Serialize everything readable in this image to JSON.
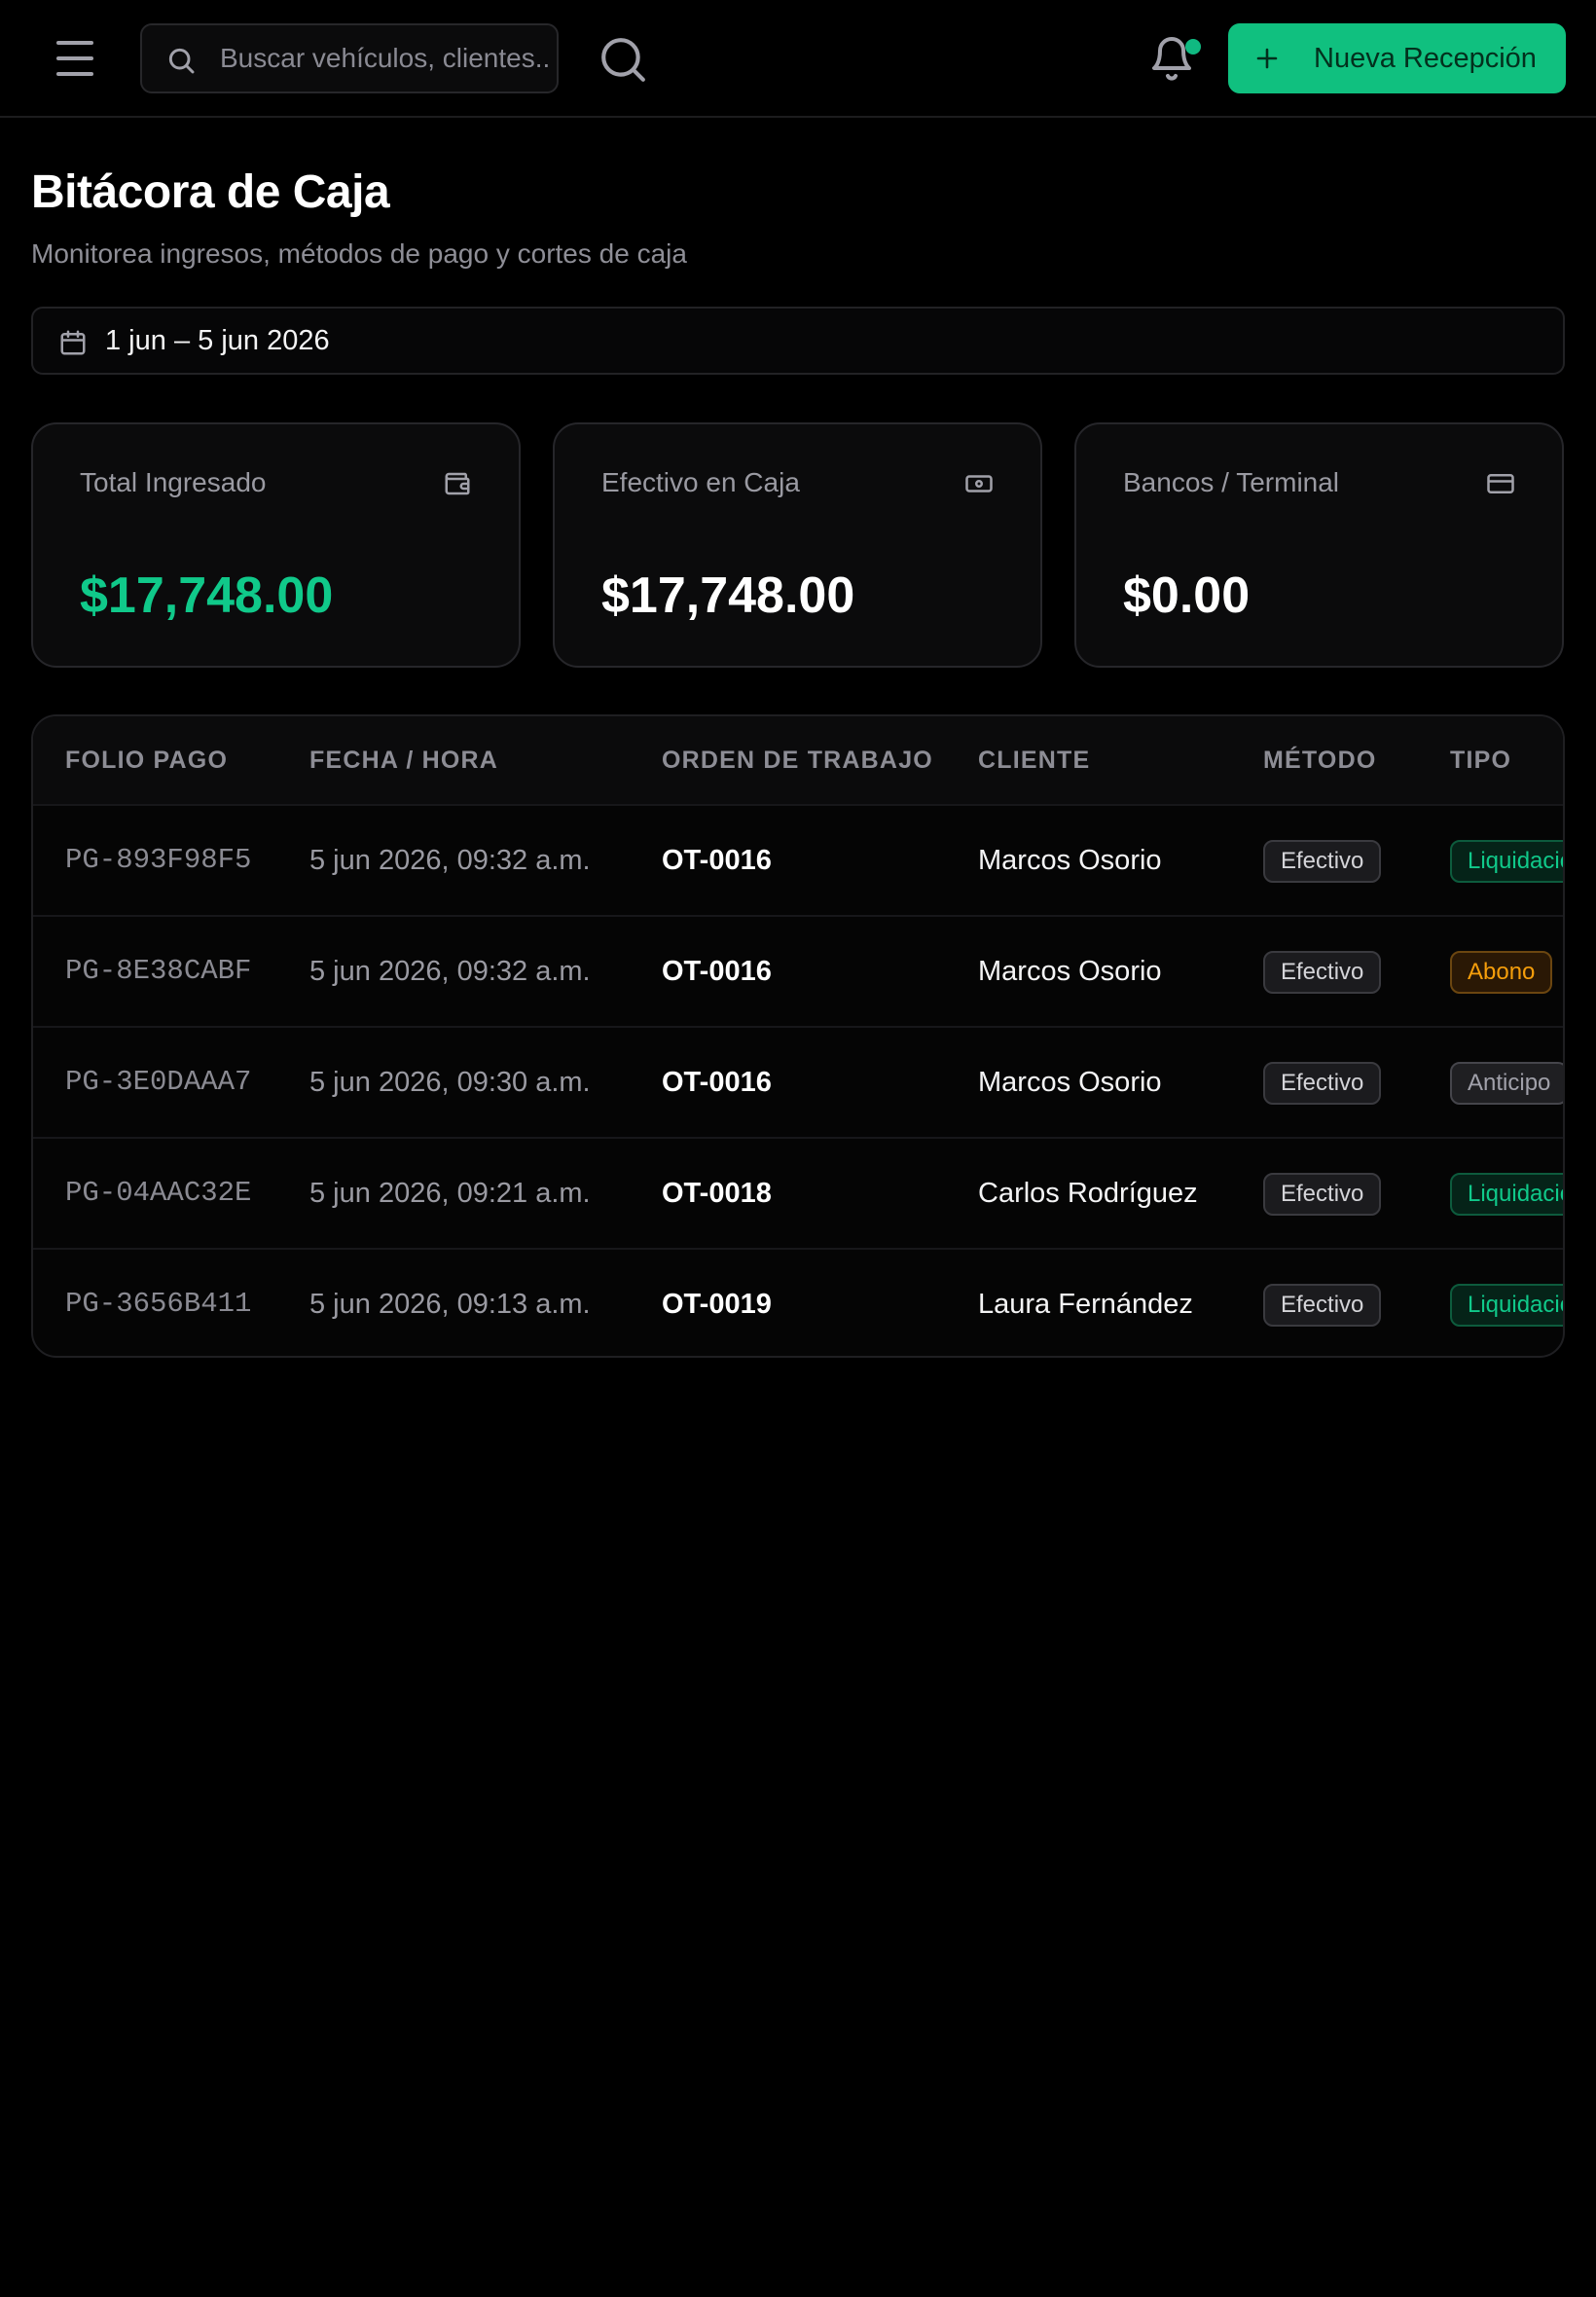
{
  "topbar": {
    "search_placeholder": "Buscar vehículos, clientes...",
    "new_button_label": "Nueva Recepción",
    "accent_color": "#10c07f",
    "notification_dot": true
  },
  "header": {
    "title": "Bitácora de Caja",
    "subtitle": "Monitorea ingresos, métodos de pago y cortes de caja",
    "date_range": "1 jun – 5 jun 2026"
  },
  "cards": [
    {
      "label": "Total Ingresado",
      "value": "$17,748.00",
      "icon": "wallet-icon"
    },
    {
      "label": "Efectivo en Caja",
      "value": "$17,748.00",
      "icon": "banknote-icon"
    },
    {
      "label": "Bancos / Terminal",
      "value": "$0.00",
      "icon": "credit-card-icon"
    }
  ],
  "table": {
    "columns": [
      "FOLIO PAGO",
      "FECHA / HORA",
      "ORDEN DE TRABAJO",
      "CLIENTE",
      "MÉTODO",
      "TIPO"
    ],
    "rows": [
      {
        "folio": "PG-893F98F5",
        "fecha": "5 jun 2026, 09:32 a.m.",
        "orden": "OT-0016",
        "cliente": "Marcos Osorio",
        "metodo": "Efectivo",
        "tipo": "Liquidación",
        "tipo_kind": "liq"
      },
      {
        "folio": "PG-8E38CABF",
        "fecha": "5 jun 2026, 09:32 a.m.",
        "orden": "OT-0016",
        "cliente": "Marcos Osorio",
        "metodo": "Efectivo",
        "tipo": "Abono",
        "tipo_kind": "abono"
      },
      {
        "folio": "PG-3E0DAAA7",
        "fecha": "5 jun 2026, 09:30 a.m.",
        "orden": "OT-0016",
        "cliente": "Marcos Osorio",
        "metodo": "Efectivo",
        "tipo": "Anticipo",
        "tipo_kind": "anticipo"
      },
      {
        "folio": "PG-04AAC32E",
        "fecha": "5 jun 2026, 09:21 a.m.",
        "orden": "OT-0018",
        "cliente": "Carlos Rodríguez",
        "metodo": "Efectivo",
        "tipo": "Liquidación",
        "tipo_kind": "liq"
      },
      {
        "folio": "PG-3656B411",
        "fecha": "5 jun 2026, 09:13 a.m.",
        "orden": "OT-0019",
        "cliente": "Laura Fernández",
        "metodo": "Efectivo",
        "tipo": "Liquidación",
        "tipo_kind": "liq"
      }
    ]
  }
}
